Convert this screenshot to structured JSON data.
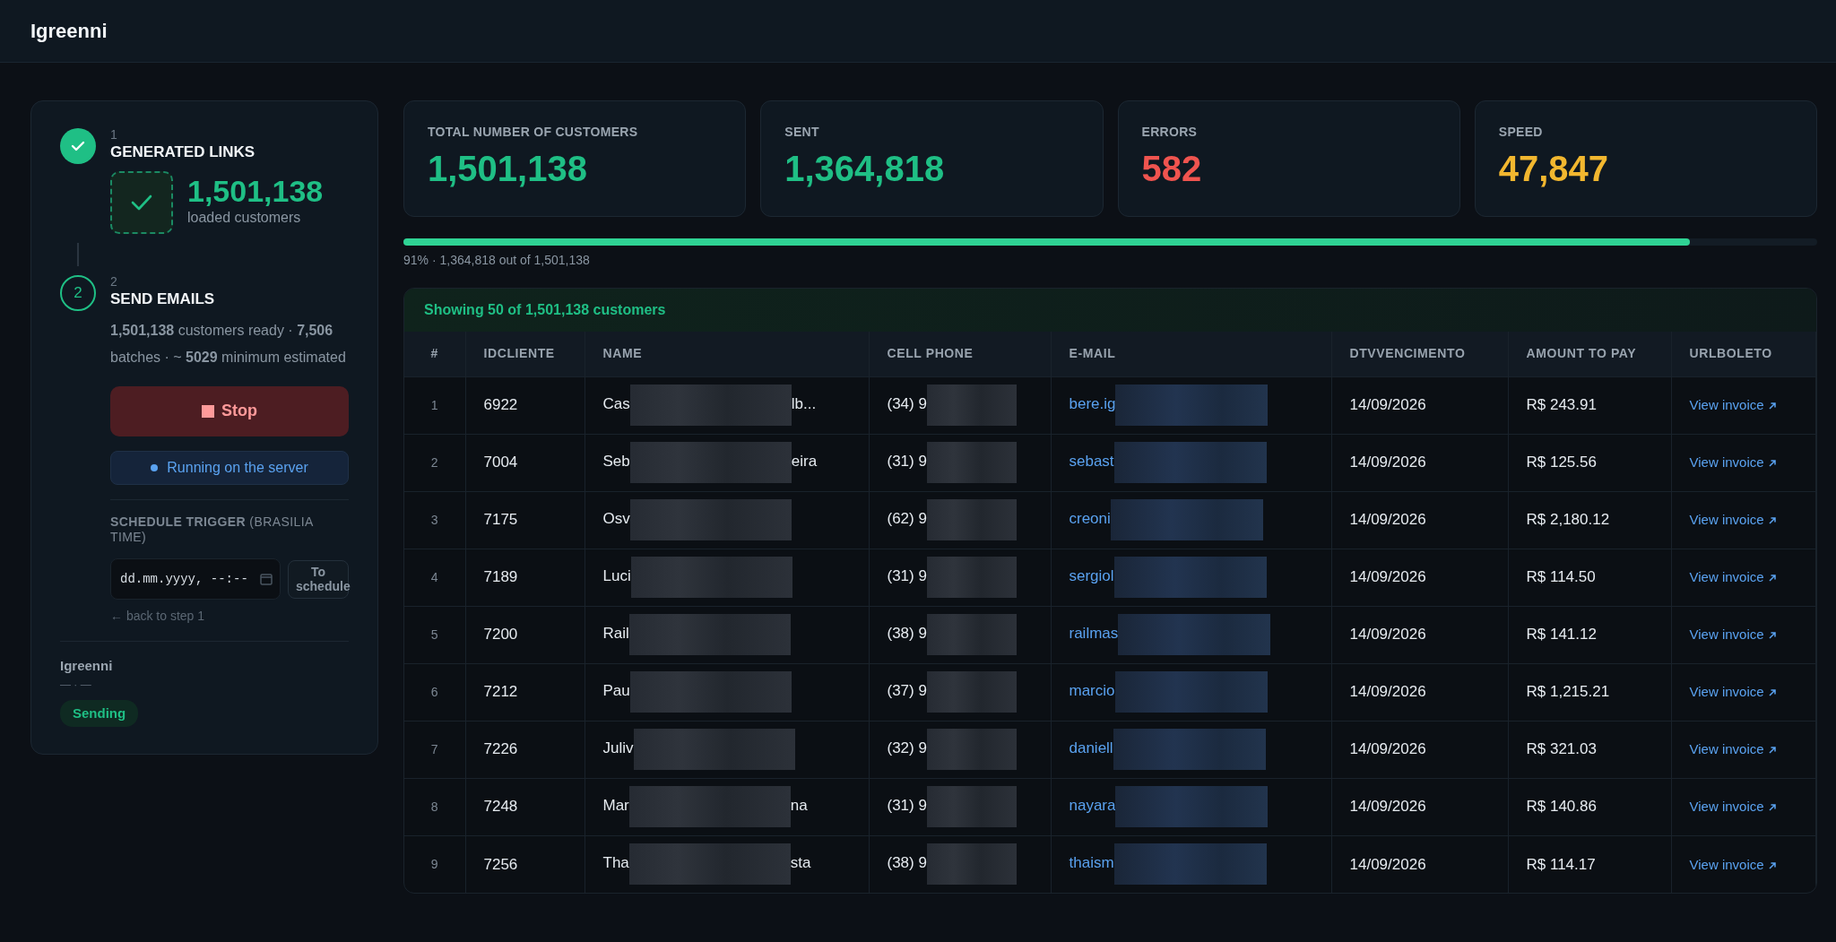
{
  "app": {
    "title": "Igreenni"
  },
  "steps": [
    {
      "number": "1",
      "title": "GENERATED LINKS",
      "done": true,
      "count": "1,501,138",
      "count_label": "loaded customers"
    },
    {
      "number": "2",
      "title": "SEND EMAILS",
      "done": false,
      "marker": "2",
      "summary": "**1,501,138** customers ready · **7,506** batches · ~ **5029** minimum estimated",
      "stop_button": "Stop",
      "server_status": "Running on the server",
      "schedule_label": "**SCHEDULE TRIGGER** (BRASILIA TIME)",
      "datetime_placeholder": "dd.mm.yyyy, --:--",
      "schedule_button": "To schedule",
      "back_link": "← back to step 1"
    }
  ],
  "sidebar_footer": {
    "name": "Igreenni",
    "detail": "— · —",
    "badge": "Sending"
  },
  "stats": [
    {
      "label": "TOTAL NUMBER OF CUSTOMERS",
      "value": "1,501,138",
      "color": "#1fbf85"
    },
    {
      "label": "SENT",
      "value": "1,364,818",
      "color": "#1fbf85"
    },
    {
      "label": "ERRORS",
      "value": "582",
      "color": "#f0544f"
    },
    {
      "label": "SPEED",
      "value": "47,847",
      "color": "#f2b72f"
    }
  ],
  "progress": {
    "level": 0.91,
    "caption": "91% · 1,364,818 out of 1,501,138"
  },
  "table": {
    "caption": "Showing 50 of 1,501,138 customers",
    "columns": [
      "#",
      "IDCLIENTE",
      "NAME",
      "CELL PHONE",
      "E-MAIL",
      "DTVVENCIMENTO",
      "AMOUNT TO PAY",
      "URLBOLETO"
    ],
    "rows": [
      {
        "index": "1",
        "id": "6922",
        "name_start": "Cas",
        "name_end": "lb...",
        "phone": "(34) 9",
        "email": "bere.ig",
        "due": "14/09/2026",
        "amount": "R$ 243.91",
        "link": "View invoice"
      },
      {
        "index": "2",
        "id": "7004",
        "name_start": "Seb",
        "name_end": "eira",
        "phone": "(31) 9",
        "email": "sebast",
        "due": "14/09/2026",
        "amount": "R$ 125.56",
        "link": "View invoice"
      },
      {
        "index": "3",
        "id": "7175",
        "name_start": "Osv",
        "phone": "(62) 9",
        "email": "creoni",
        "due": "14/09/2026",
        "amount": "R$ 2,180.12",
        "link": "View invoice"
      },
      {
        "index": "4",
        "id": "7189",
        "name_start": "Luci",
        "phone": "(31) 9",
        "email": "sergiol",
        "due": "14/09/2026",
        "amount": "R$ 114.50",
        "link": "View invoice"
      },
      {
        "index": "5",
        "id": "7200",
        "name_start": "Rail",
        "phone": "(38) 9",
        "email": "railmas",
        "due": "14/09/2026",
        "amount": "R$ 141.12",
        "link": "View invoice"
      },
      {
        "index": "6",
        "id": "7212",
        "name_start": "Pau",
        "phone": "(37) 9",
        "email": "marcio",
        "due": "14/09/2026",
        "amount": "R$ 1,215.21",
        "link": "View invoice"
      },
      {
        "index": "7",
        "id": "7226",
        "name_start": "Juliv",
        "phone": "(32) 9",
        "email": "daniell",
        "due": "14/09/2026",
        "amount": "R$ 321.03",
        "link": "View invoice"
      },
      {
        "index": "8",
        "id": "7248",
        "name_start": "Mar",
        "name_end": "na",
        "phone": "(31) 9",
        "email": "nayara",
        "due": "14/09/2026",
        "amount": "R$ 140.86",
        "link": "View invoice"
      },
      {
        "index": "9",
        "id": "7256",
        "name_start": "Tha",
        "name_end": "sta",
        "phone": "(38) 9",
        "email": "thaism",
        "due": "14/09/2026",
        "amount": "R$ 114.17",
        "link": "View invoice"
      }
    ]
  }
}
